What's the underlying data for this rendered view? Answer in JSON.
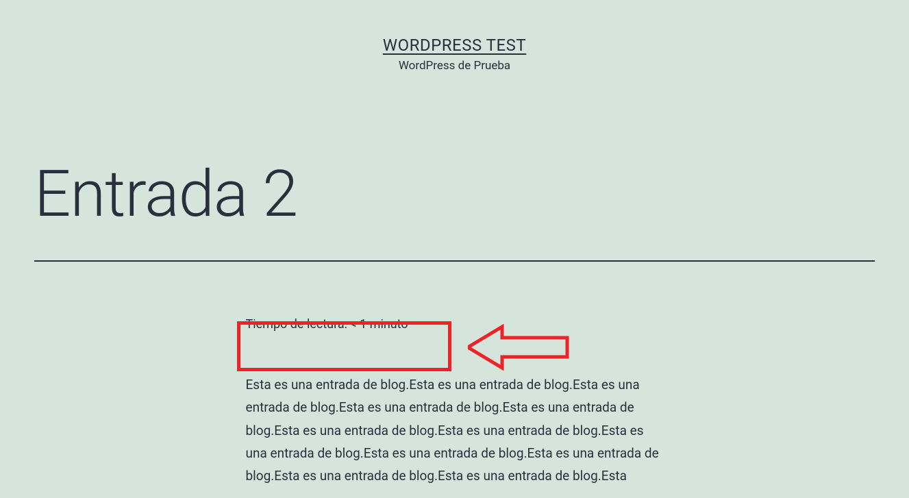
{
  "header": {
    "site_title": "WORDPRESS TEST",
    "tagline": "WordPress de Prueba"
  },
  "post": {
    "title": "Entrada 2",
    "reading_time": "Tiempo de lectura: < 1 minuto",
    "body": "Esta es una entrada de blog.Esta es una entrada de blog.Esta es una entrada de blog.Esta es una entrada de blog.Esta es una entrada de blog.Esta es una entrada de blog.Esta es una entrada de blog.Esta es una entrada de blog.Esta es una entrada de blog.Esta es una entrada de blog.Esta es una entrada de blog.Esta es una entrada de blog.Esta"
  },
  "annotation": {
    "box_color": "#ec2427",
    "arrow_color": "#ec2427"
  }
}
